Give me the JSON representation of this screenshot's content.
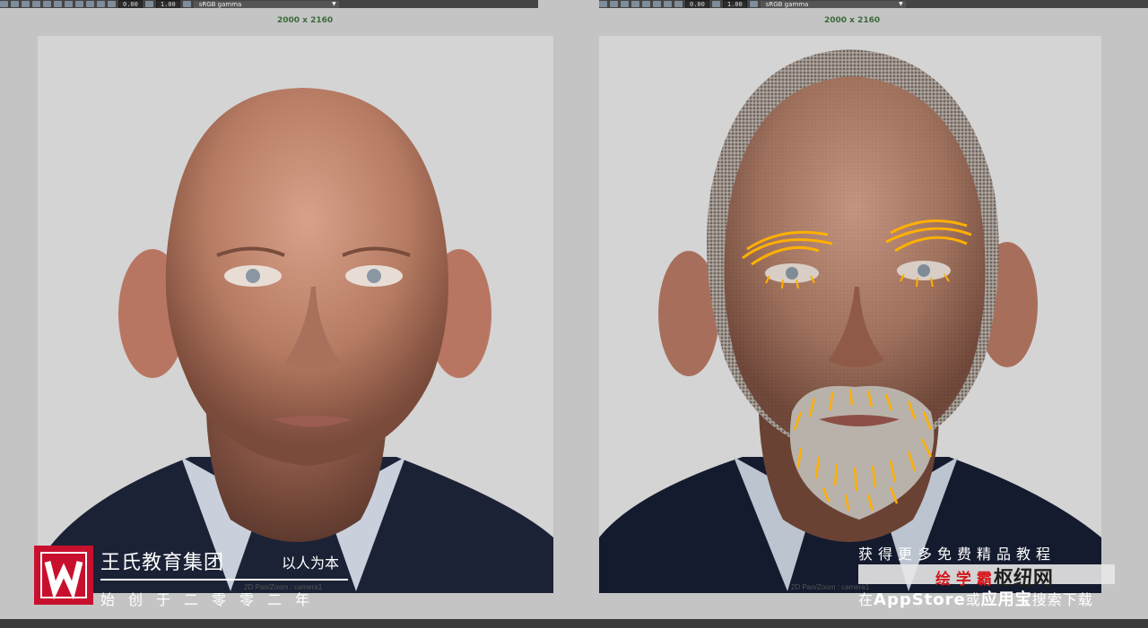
{
  "toolbar": {
    "left": {
      "value_a": "0.00",
      "value_b": "1.00",
      "color_space": "sRGB gamma"
    },
    "right": {
      "value_a": "0.00",
      "value_b": "1.00",
      "color_space": "sRGB gamma"
    }
  },
  "viewports": [
    {
      "resolution": "2000 x 2160",
      "caption": "2D Pan/Zoom : camera1"
    },
    {
      "resolution": "2000 x 2160",
      "caption": "2D Pan/Zoom : camera1"
    }
  ],
  "watermark_left": {
    "title": "王氏教育集团",
    "motto": "以人为本",
    "founded": "始创于二零零二年"
  },
  "watermark_right": {
    "line1": "获得更多免费精品教程",
    "badge_red": "绘 学 霸",
    "badge_dark": "枢纽网",
    "line3_prefix": "在",
    "line3_appstore": "AppStore",
    "line3_or": "或",
    "line3_app": "应用宝",
    "line3_suffix": "搜索下载"
  },
  "colors": {
    "app_bg": "#c4c4c4",
    "viewport_bg": "#d4d4d4",
    "toolbar_bg": "#444444",
    "resolution_label": "#3a6a3a",
    "hair_guides": "#ffb000",
    "logo_red": "#c8102e"
  }
}
